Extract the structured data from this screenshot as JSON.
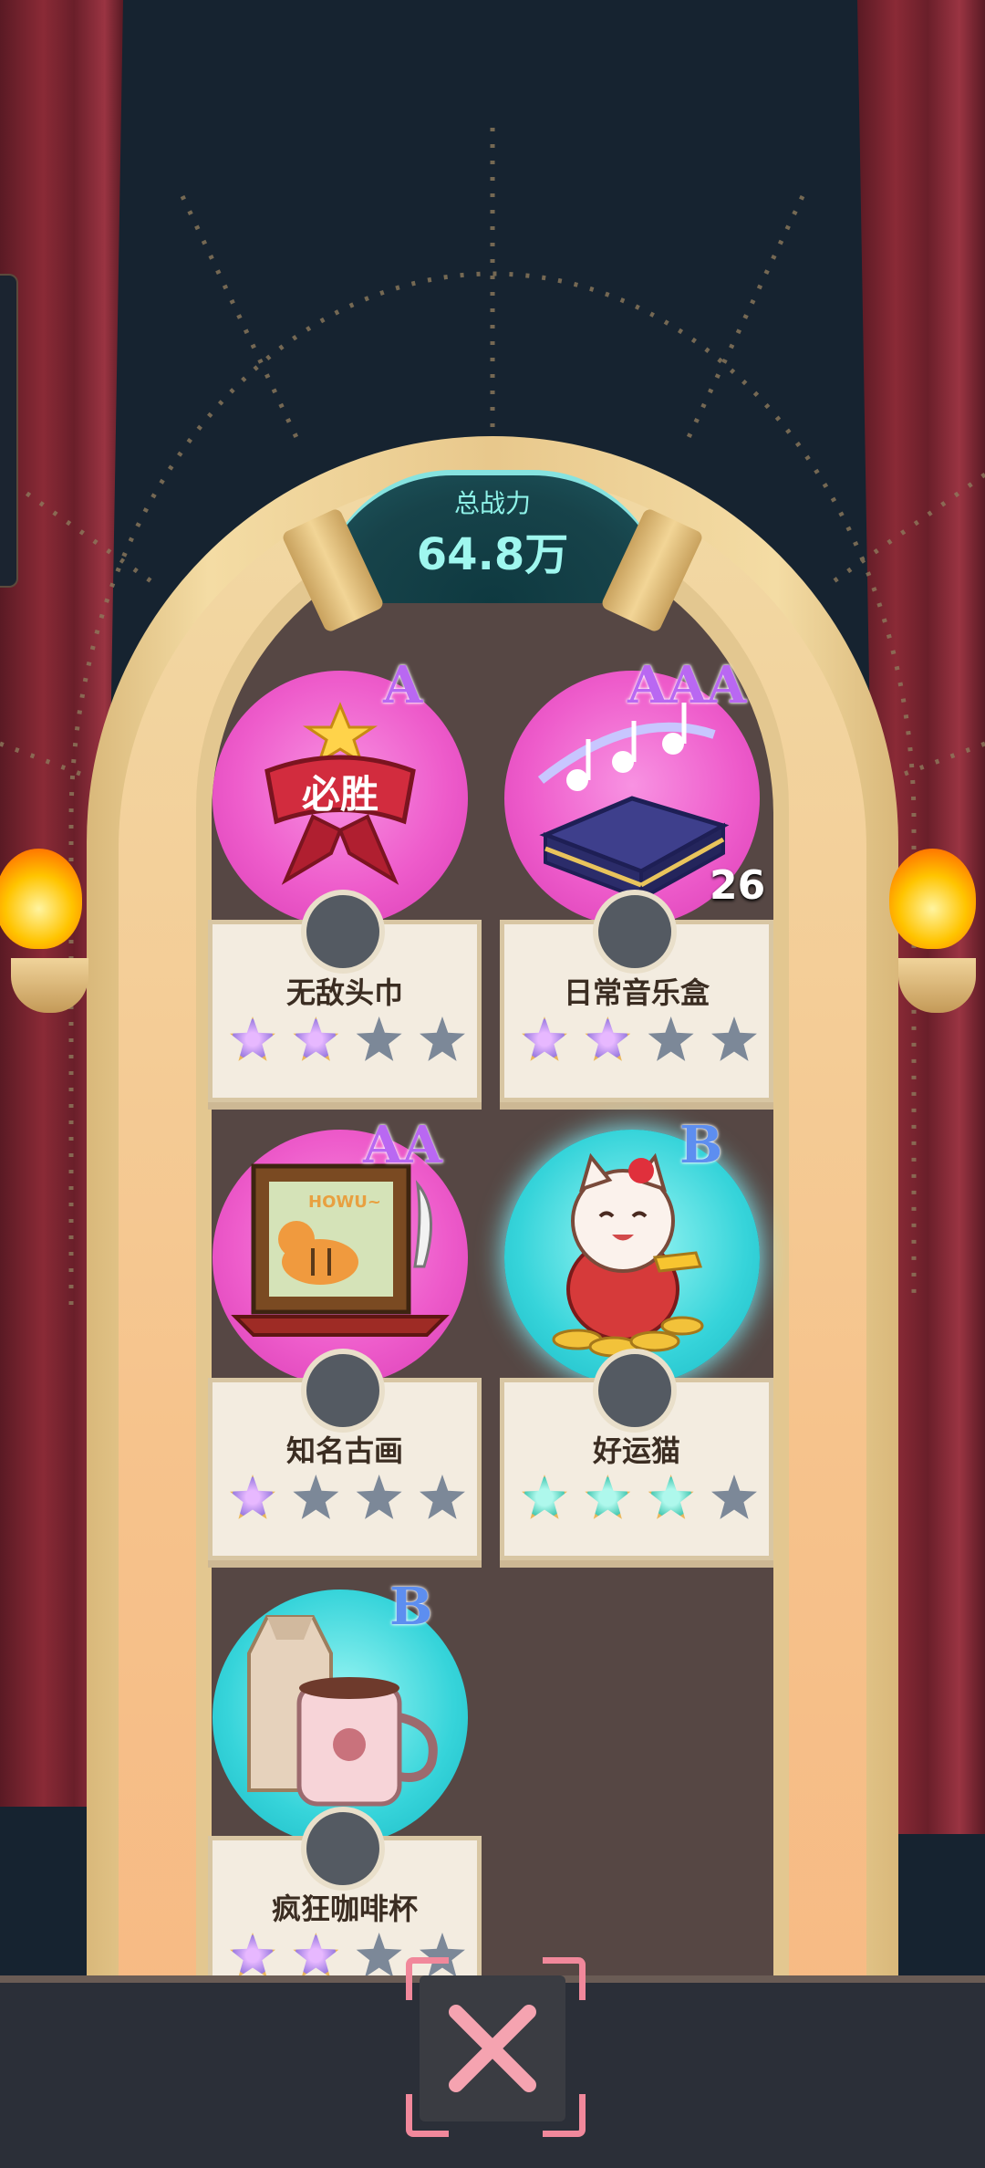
{
  "header": {
    "power_label": "总战力",
    "power_value": "64.8万"
  },
  "items": [
    {
      "name": "无敌头巾",
      "grade": "A",
      "stars": 2,
      "max_stars": 4,
      "orb_color": "#ee5ccb",
      "icon": "victory-headband-icon",
      "badge_text": "必胜"
    },
    {
      "name": "日常音乐盒",
      "grade": "AAA",
      "stars": 2,
      "max_stars": 4,
      "orb_color": "#ee5ccb",
      "icon": "music-box-icon",
      "count": "26"
    },
    {
      "name": "知名古画",
      "grade": "AA",
      "stars": 1,
      "max_stars": 4,
      "orb_color": "#ee5ccb",
      "icon": "tiger-painting-icon",
      "painting_text": "HOWU~"
    },
    {
      "name": "好运猫",
      "grade": "B",
      "stars": 3,
      "max_stars": 4,
      "orb_color": "#36d4da",
      "icon": "lucky-cat-icon"
    },
    {
      "name": "疯狂咖啡杯",
      "grade": "B",
      "stars": 2,
      "max_stars": 4,
      "orb_color": "#36d4da",
      "icon": "coffee-cup-icon"
    }
  ],
  "controls": {
    "close_icon": "close-icon"
  },
  "colors": {
    "accent_cyan": "#8ef2e8",
    "close_pink": "#f1889b",
    "curtain": "#8a2a36"
  }
}
